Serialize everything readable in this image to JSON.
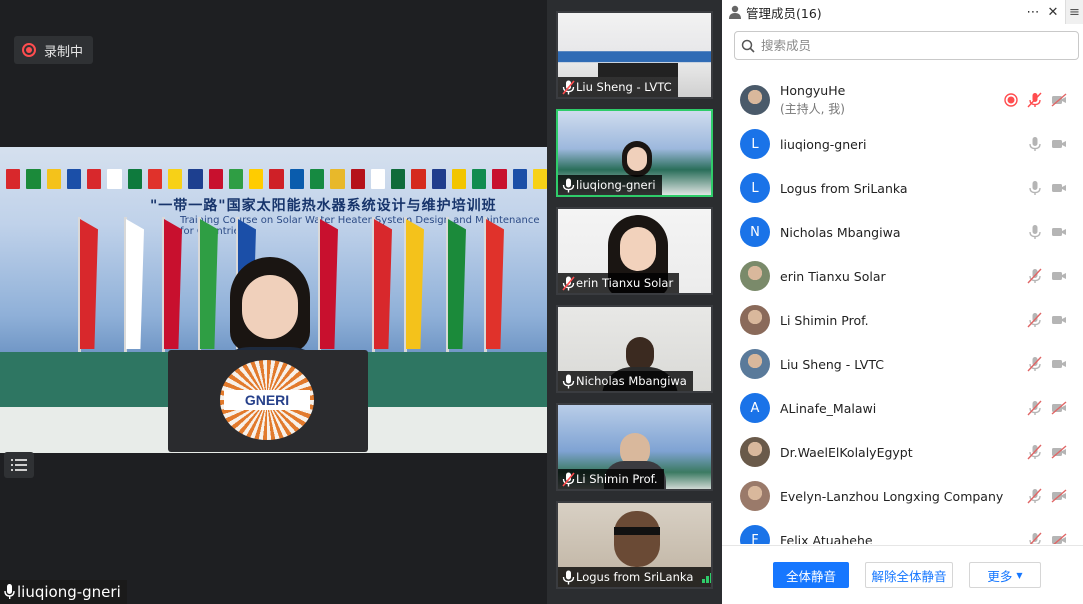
{
  "recording": {
    "label": "录制中"
  },
  "main_video": {
    "speaker_name": "liuqiong-gneri",
    "banner_zh": "\"一带一路\"国家太阳能热水器系统设计与维护培训班",
    "banner_en": "Training Course on Solar Water Heater System Design and Maintenance for Countries",
    "laptop_logo": "GNERI"
  },
  "thumbnails": [
    {
      "name": "Liu Sheng - LVTC",
      "mic": "muted",
      "active": false
    },
    {
      "name": "liuqiong-gneri",
      "mic": "on",
      "active": true
    },
    {
      "name": "erin Tianxu Solar",
      "mic": "muted",
      "active": false
    },
    {
      "name": "Nicholas Mbangiwa",
      "mic": "on",
      "active": false
    },
    {
      "name": "Li Shimin Prof.",
      "mic": "muted",
      "active": false
    },
    {
      "name": "Logus from SriLanka",
      "mic": "on",
      "active": false,
      "signal": true
    }
  ],
  "panel": {
    "title": "管理成员(16)",
    "search_placeholder": "搜索成员",
    "members": [
      {
        "name": "HongyuHe",
        "sub": "(主持人, 我)",
        "avatar": "photo",
        "avatar_letter": "",
        "recording": true,
        "mic": "muted",
        "video": "off",
        "mic_color": "#ff4d4f"
      },
      {
        "name": "liuqiong-gneri",
        "sub": "",
        "avatar": "letter",
        "avatar_letter": "L",
        "recording": false,
        "mic": "on",
        "video": "on"
      },
      {
        "name": "Logus from SriLanka",
        "sub": "",
        "avatar": "letter",
        "avatar_letter": "L",
        "recording": false,
        "mic": "on",
        "video": "on"
      },
      {
        "name": "Nicholas Mbangiwa",
        "sub": "",
        "avatar": "letter",
        "avatar_letter": "N",
        "recording": false,
        "mic": "on",
        "video": "on"
      },
      {
        "name": "erin Tianxu Solar",
        "sub": "",
        "avatar": "photo",
        "avatar_letter": "",
        "recording": false,
        "mic": "muted",
        "video": "on"
      },
      {
        "name": "Li Shimin Prof.",
        "sub": "",
        "avatar": "photo",
        "avatar_letter": "",
        "recording": false,
        "mic": "muted",
        "video": "on"
      },
      {
        "name": "Liu Sheng - LVTC",
        "sub": "",
        "avatar": "photo",
        "avatar_letter": "",
        "recording": false,
        "mic": "muted",
        "video": "on"
      },
      {
        "name": "ALinafe_Malawi",
        "sub": "",
        "avatar": "letter",
        "avatar_letter": "A",
        "recording": false,
        "mic": "muted",
        "video": "off"
      },
      {
        "name": "Dr.WaelElKolalyEgypt",
        "sub": "",
        "avatar": "photo",
        "avatar_letter": "",
        "recording": false,
        "mic": "muted",
        "video": "off"
      },
      {
        "name": "Evelyn-Lanzhou Longxing Company",
        "sub": "",
        "avatar": "photo",
        "avatar_letter": "",
        "recording": false,
        "mic": "muted",
        "video": "off"
      },
      {
        "name": "Felix Atuahehe",
        "sub": "",
        "avatar": "letter",
        "avatar_letter": "F",
        "recording": false,
        "mic": "muted",
        "video": "off"
      }
    ],
    "buttons": {
      "mute_all": "全体静音",
      "unmute_all": "解除全体静音",
      "more": "更多"
    }
  },
  "colors": {
    "accent": "#1677ff",
    "active_border": "#2fcc6a",
    "muted_red": "#ff4d4f",
    "avatar_blue": "#1a73e8"
  }
}
